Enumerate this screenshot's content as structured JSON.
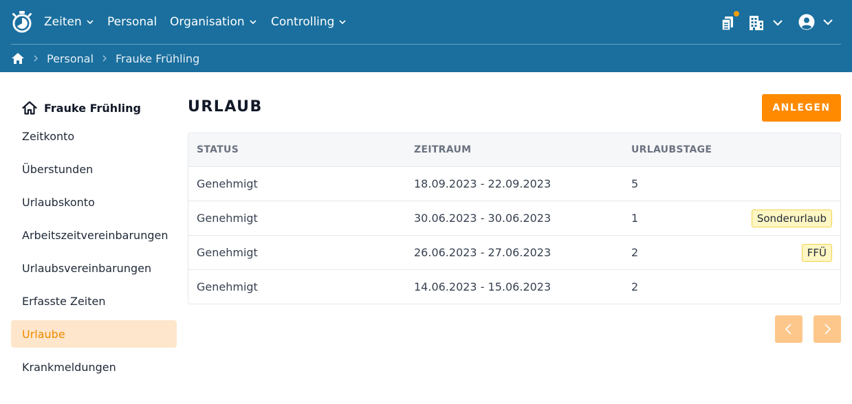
{
  "nav": {
    "items": [
      {
        "label": "Zeiten",
        "has_dropdown": true
      },
      {
        "label": "Personal",
        "has_dropdown": false
      },
      {
        "label": "Organisation",
        "has_dropdown": true
      },
      {
        "label": "Controlling",
        "has_dropdown": true
      }
    ],
    "icons": [
      "stopwatch-logo-icon",
      "clipboard-notification-icon",
      "building-icon",
      "user-account-icon"
    ],
    "colors": {
      "bar": "#1a6f9e",
      "notification": "#f59e0b"
    }
  },
  "breadcrumb": {
    "items": [
      "Personal",
      "Frauke Frühling"
    ]
  },
  "sidebar": {
    "person": "Frauke Frühling",
    "items": [
      {
        "label": "Zeitkonto",
        "active": false
      },
      {
        "label": "Überstunden",
        "active": false
      },
      {
        "label": "Urlaubskonto",
        "active": false
      },
      {
        "label": "Arbeitszeitvereinbarungen",
        "active": false
      },
      {
        "label": "Urlaubsvereinbarungen",
        "active": false
      },
      {
        "label": "Erfasste Zeiten",
        "active": false
      },
      {
        "label": "Urlaube",
        "active": true
      },
      {
        "label": "Krankmeldungen",
        "active": false
      }
    ]
  },
  "main": {
    "title": "URLAUB",
    "create_label": "ANLEGEN",
    "accent": "#ff8a00",
    "table": {
      "headers": [
        "STATUS",
        "ZEITRAUM",
        "URLAUBSTAGE"
      ],
      "rows": [
        {
          "status": "Genehmigt",
          "range": "18.09.2023 - 22.09.2023",
          "days": "5",
          "tag": ""
        },
        {
          "status": "Genehmigt",
          "range": "30.06.2023 - 30.06.2023",
          "days": "1",
          "tag": "Sonderurlaub"
        },
        {
          "status": "Genehmigt",
          "range": "26.06.2023 - 27.06.2023",
          "days": "2",
          "tag": "FFÜ"
        },
        {
          "status": "Genehmigt",
          "range": "14.06.2023 - 15.06.2023",
          "days": "2",
          "tag": ""
        }
      ]
    }
  }
}
